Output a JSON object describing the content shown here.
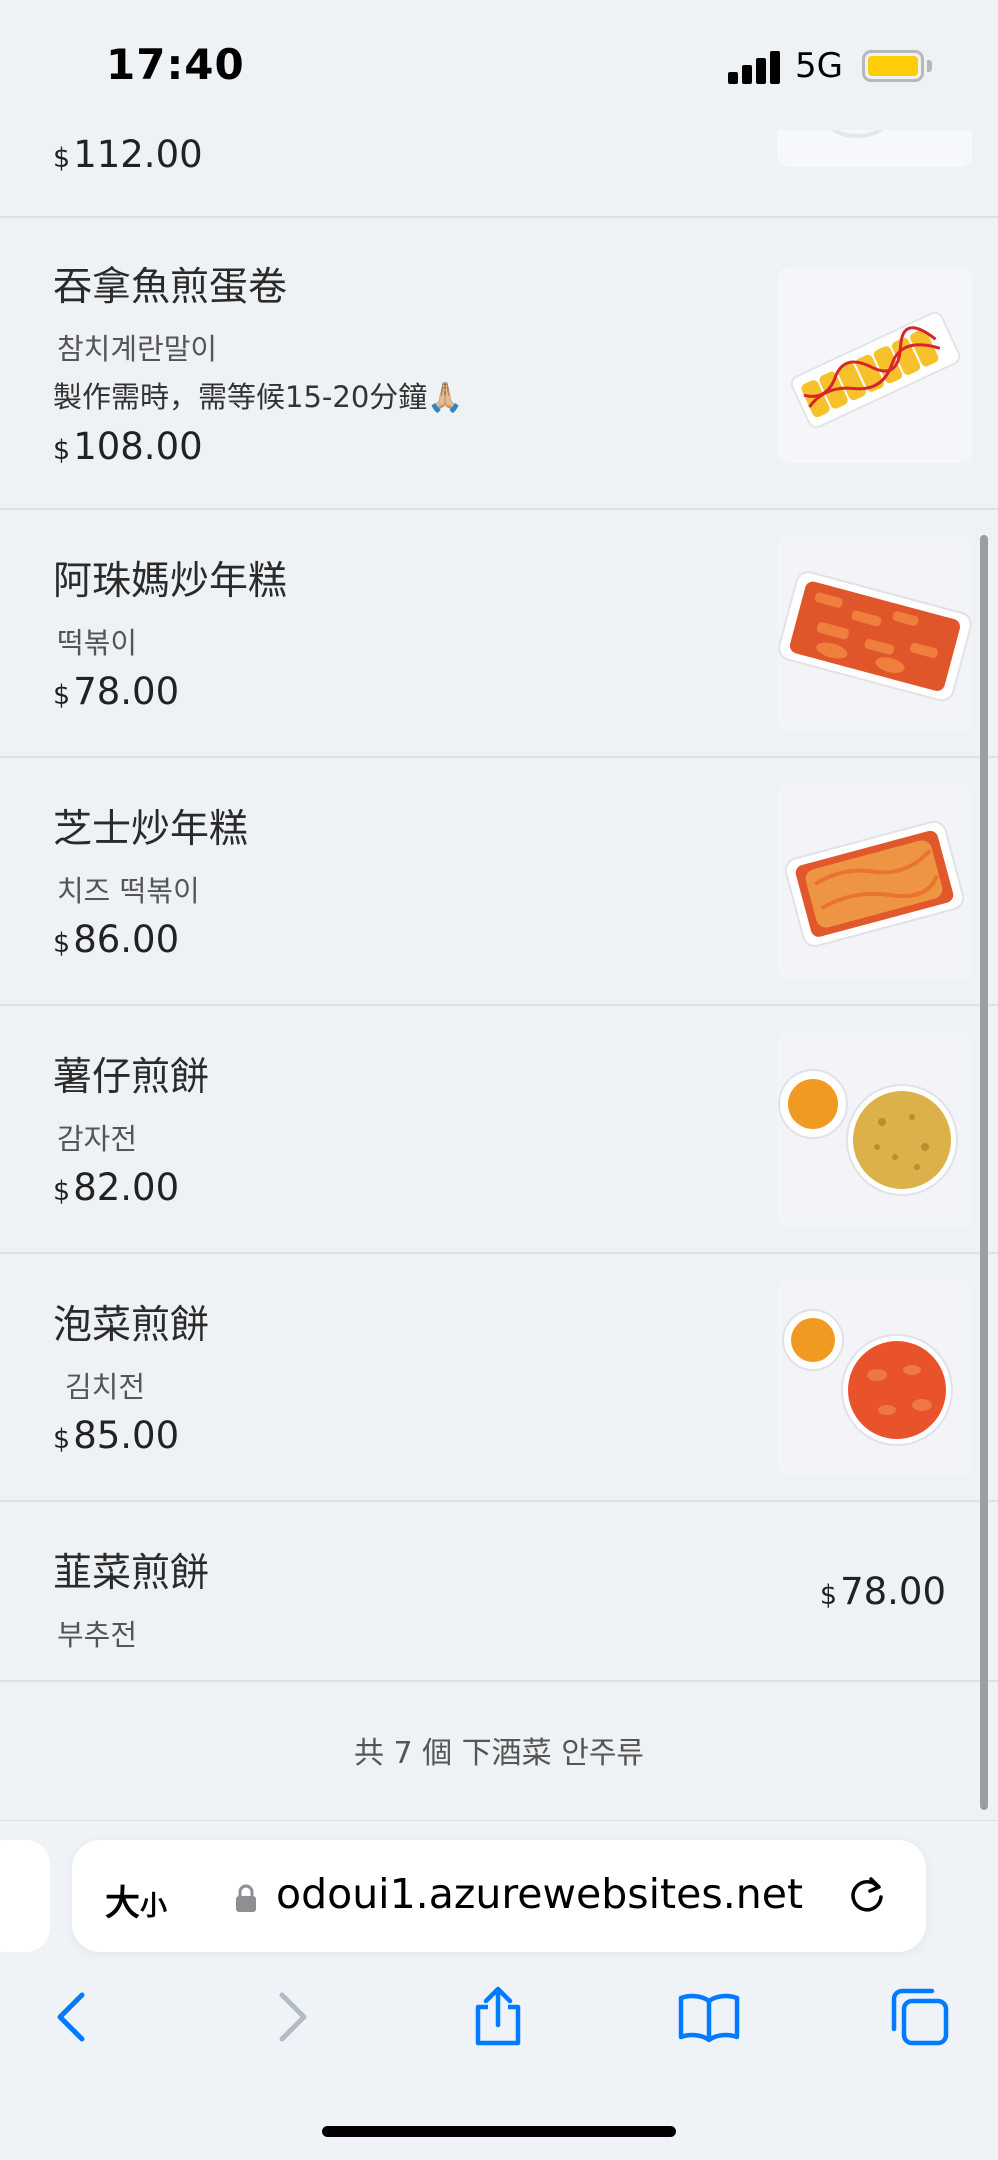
{
  "status_bar": {
    "time": "17:40",
    "network": "5G"
  },
  "menu_items": [
    {
      "name": "",
      "sub": "",
      "price": "112.00",
      "image_icon": "food-partial-icon"
    },
    {
      "name": "吞拿魚煎蛋卷",
      "sub": "참치계란말이",
      "note": "製作需時，需等候15-20分鐘🙏🏼",
      "price": "108.00",
      "image_icon": "tuna-omelette-roll-icon"
    },
    {
      "name": "阿珠媽炒年糕",
      "sub": "떡볶이",
      "price": "78.00",
      "image_icon": "tteokbokki-icon"
    },
    {
      "name": "芝士炒年糕",
      "sub": "치즈 떡볶이",
      "price": "86.00",
      "image_icon": "cheese-tteokbokki-icon"
    },
    {
      "name": "薯仔煎餅",
      "sub": "감자전",
      "price": "82.00",
      "image_icon": "potato-pancake-icon"
    },
    {
      "name": "泡菜煎餅",
      "sub": "김치전",
      "price": "85.00",
      "image_icon": "kimchi-pancake-icon"
    },
    {
      "name": "韮菜煎餅",
      "sub": "부추전",
      "price": "78.00"
    }
  ],
  "currency_symbol": "$",
  "count_text": "共 7 個 下酒菜 안주류",
  "browser": {
    "text_size_big": "大",
    "text_size_small": "小",
    "url": "odoui1.azurewebsites.net"
  },
  "colors": {
    "accent": "#007aff",
    "disabled": "#b4bcc6",
    "battery": "#ffcc0a"
  }
}
